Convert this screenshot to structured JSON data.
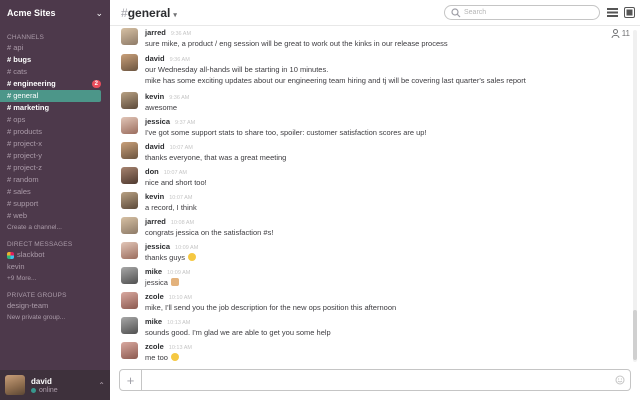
{
  "team": {
    "name": "Acme Sites"
  },
  "sidebar": {
    "channels_title": "CHANNELS",
    "channels": [
      {
        "label": "# api"
      },
      {
        "label": "# bugs"
      },
      {
        "label": "# cats"
      },
      {
        "label": "# engineering",
        "badge": "2"
      },
      {
        "label": "# general"
      },
      {
        "label": "# marketing"
      },
      {
        "label": "# ops"
      },
      {
        "label": "# products"
      },
      {
        "label": "# project-x"
      },
      {
        "label": "# project-y"
      },
      {
        "label": "# project-z"
      },
      {
        "label": "# random"
      },
      {
        "label": "# sales"
      },
      {
        "label": "# support"
      },
      {
        "label": "# web"
      }
    ],
    "create_channel": "Create a channel...",
    "dm_title": "DIRECT MESSAGES",
    "dms": [
      {
        "label": "slackbot"
      },
      {
        "label": "kevin"
      }
    ],
    "more": "+9 More...",
    "private_title": "PRIVATE GROUPS",
    "groups": [
      {
        "label": "design-team"
      }
    ],
    "new_private_group": "New private group..."
  },
  "user": {
    "name": "david",
    "status": "online"
  },
  "header": {
    "hash": "#",
    "channel": "general",
    "search_placeholder": "Search",
    "member_count": "11"
  },
  "messages": [
    {
      "sender": "jarred",
      "time": "9:36 AM",
      "lines": [
        "sure mike, a product / eng session will be great to work out the kinks in our release process"
      ]
    },
    {
      "sender": "david",
      "time": "9:36 AM",
      "lines": [
        "our Wednesday all-hands will be starting in 10 minutes.",
        "mike has some exciting updates about our engineering team hiring and tj will be covering last quarter's sales report"
      ]
    },
    {
      "sender": "kevin",
      "time": "9:36 AM",
      "lines": [
        "awesome"
      ]
    },
    {
      "sender": "jessica",
      "time": "9:37 AM",
      "lines": [
        "I've got some support stats to share too, spoiler: customer satisfaction scores are up!"
      ]
    },
    {
      "sender": "david",
      "time": "10:07 AM",
      "lines": [
        "thanks everyone, that was a great meeting"
      ]
    },
    {
      "sender": "don",
      "time": "10:07 AM",
      "lines": [
        "nice and short too!"
      ]
    },
    {
      "sender": "kevin",
      "time": "10:07 AM",
      "lines": [
        "a record, I think"
      ]
    },
    {
      "sender": "jarred",
      "time": "10:08 AM",
      "lines": [
        "congrats jessica on the satisfaction #s!"
      ]
    },
    {
      "sender": "jessica",
      "time": "10:09 AM",
      "lines": [
        "thanks guys"
      ],
      "emoji": "smile"
    },
    {
      "sender": "mike",
      "time": "10:09 AM",
      "lines": [
        "jessica"
      ],
      "emoji": "thumbs-up"
    },
    {
      "sender": "zcole",
      "time": "10:10 AM",
      "lines": [
        "mike, I'll send you the job description for the new ops position this afternoon"
      ]
    },
    {
      "sender": "mike",
      "time": "10:13 AM",
      "lines": [
        "sounds good. I'm glad we are able to get you some help"
      ]
    },
    {
      "sender": "zcole",
      "time": "10:13 AM",
      "lines": [
        "me too"
      ],
      "emoji": "smile"
    }
  ],
  "colors": {
    "sidebar": "#4d394b",
    "active_channel": "#4c9689",
    "badge": "#eb4d5c",
    "presence": "#38978d"
  }
}
